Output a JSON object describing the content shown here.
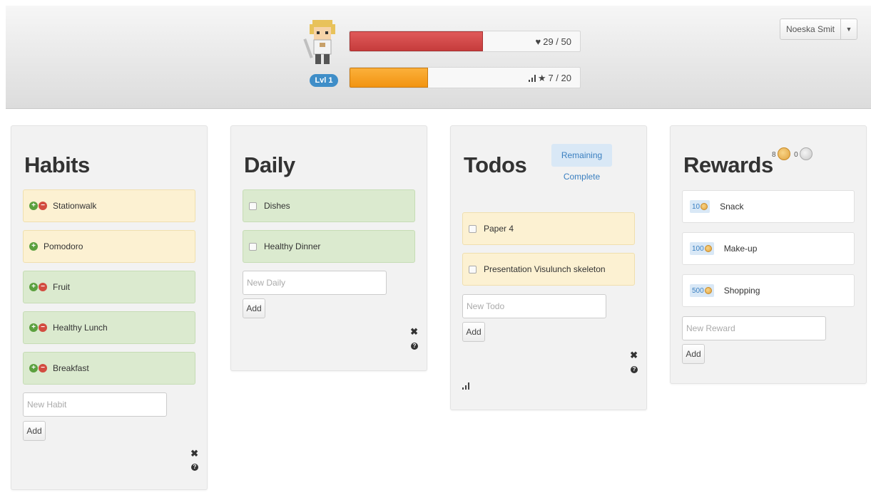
{
  "header": {
    "level": "Lvl 1",
    "hp": {
      "text": "29 / 50",
      "fraction": 0.58
    },
    "xp": {
      "text": "7 / 20",
      "fraction": 0.34
    },
    "user": {
      "name": "Noeska Smit"
    },
    "icons": {
      "hp": "heart-icon",
      "xp": "star-icon",
      "user_menu": "caret-down-icon"
    },
    "colors": {
      "hp": "#c63c3c",
      "xp": "#f29411",
      "badge": "#3f8ec8"
    }
  },
  "habits": {
    "title": "Habits",
    "items": [
      {
        "label": "Stationwalk",
        "color": "yellow",
        "has_minus": true
      },
      {
        "label": "Pomodoro",
        "color": "yellow",
        "has_minus": false
      },
      {
        "label": "Fruit",
        "color": "green",
        "has_minus": true
      },
      {
        "label": "Healthy Lunch",
        "color": "green",
        "has_minus": true
      },
      {
        "label": "Breakfast",
        "color": "green",
        "has_minus": true
      }
    ],
    "input_placeholder": "New Habit",
    "add_label": "Add"
  },
  "daily": {
    "title": "Daily",
    "items": [
      {
        "label": "Dishes",
        "color": "green"
      },
      {
        "label": "Healthy Dinner",
        "color": "green"
      }
    ],
    "input_placeholder": "New Daily",
    "add_label": "Add"
  },
  "todos": {
    "title": "Todos",
    "filters": {
      "remaining": "Remaining",
      "complete": "Complete"
    },
    "items": [
      {
        "label": "Paper 4",
        "color": "yellow"
      },
      {
        "label": "Presentation Visulunch skeleton",
        "color": "yellow"
      }
    ],
    "input_placeholder": "New Todo",
    "add_label": "Add"
  },
  "rewards": {
    "title": "Rewards",
    "gold": "8",
    "silver": "0",
    "items": [
      {
        "price": "10",
        "label": "Snack"
      },
      {
        "price": "100",
        "label": "Make-up"
      },
      {
        "price": "500",
        "label": "Shopping"
      }
    ],
    "input_placeholder": "New Reward",
    "add_label": "Add"
  }
}
